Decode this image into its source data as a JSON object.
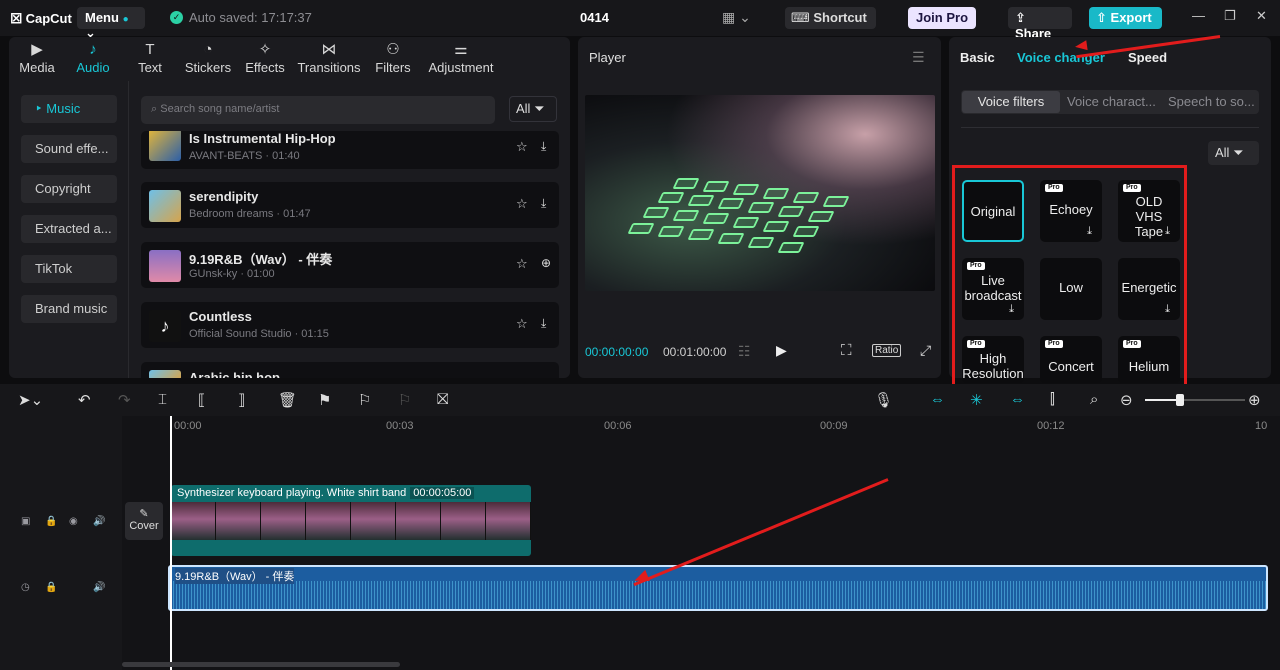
{
  "topbar": {
    "app_name": "CapCut",
    "menu": "Menu",
    "saved": "Auto saved: 17:17:37",
    "project": "0414",
    "shortcut": "Shortcut",
    "join": "Join Pro",
    "share": "Share",
    "export": "Export"
  },
  "media": {
    "tabs": [
      {
        "label": "Media",
        "icon": "media-icon"
      },
      {
        "label": "Audio",
        "icon": "audio-icon"
      },
      {
        "label": "Text",
        "icon": "text-icon"
      },
      {
        "label": "Stickers",
        "icon": "stickers-icon"
      },
      {
        "label": "Effects",
        "icon": "effects-icon"
      },
      {
        "label": "Transitions",
        "icon": "transitions-icon"
      },
      {
        "label": "Filters",
        "icon": "filters-icon"
      },
      {
        "label": "Adjustment",
        "icon": "adjustment-icon"
      }
    ],
    "sidebar": [
      "Music",
      "Sound effe...",
      "Copyright",
      "Extracted a...",
      "TikTok",
      "Brand music"
    ],
    "search_placeholder": "Search song name/artist",
    "all": "All",
    "songs": [
      {
        "name": "Is Instrumental Hip-Hop",
        "meta": "AVANT-BEATS · 01:40"
      },
      {
        "name": "serendipity",
        "meta": "Bedroom dreams · 01:47"
      },
      {
        "name": "9.19R&B（Wav） - 伴奏",
        "meta": "GUnsk-ky · 01:00"
      },
      {
        "name": "Countless",
        "meta": "Official Sound Studio · 01:15"
      },
      {
        "name": "Arabic hip hop",
        "meta": ""
      }
    ]
  },
  "player": {
    "title": "Player",
    "current": "00:00:00:00",
    "total": "00:01:00:00",
    "ratio": "Ratio"
  },
  "right": {
    "tabs": [
      "Basic",
      "Voice changer",
      "Speed"
    ],
    "subtabs": [
      "Voice filters",
      "Voice charact...",
      "Speech to so..."
    ],
    "all": "All",
    "pro_badge": "Pro",
    "effects": [
      "Original",
      "Echoey",
      "OLD VHS Tape",
      "Live broadcast",
      "Low",
      "Energetic",
      "High Resolution",
      "Concert",
      "Helium"
    ]
  },
  "timeline": {
    "ruler": [
      "00:00",
      "00:03",
      "00:06",
      "00:09",
      "00:12",
      "10"
    ],
    "cover": "Cover",
    "video_clip": {
      "title": "Synthesizer keyboard playing. White shirt band",
      "duration": "00:00:05:00"
    },
    "audio_clip": {
      "title": "9.19R&B（Wav） - 伴奏"
    }
  },
  "colors": {
    "accent": "#19c7d6",
    "annotation": "#e21c1c",
    "audio_clip": "#1c5da0",
    "video_clip": "#0e6c6c"
  }
}
